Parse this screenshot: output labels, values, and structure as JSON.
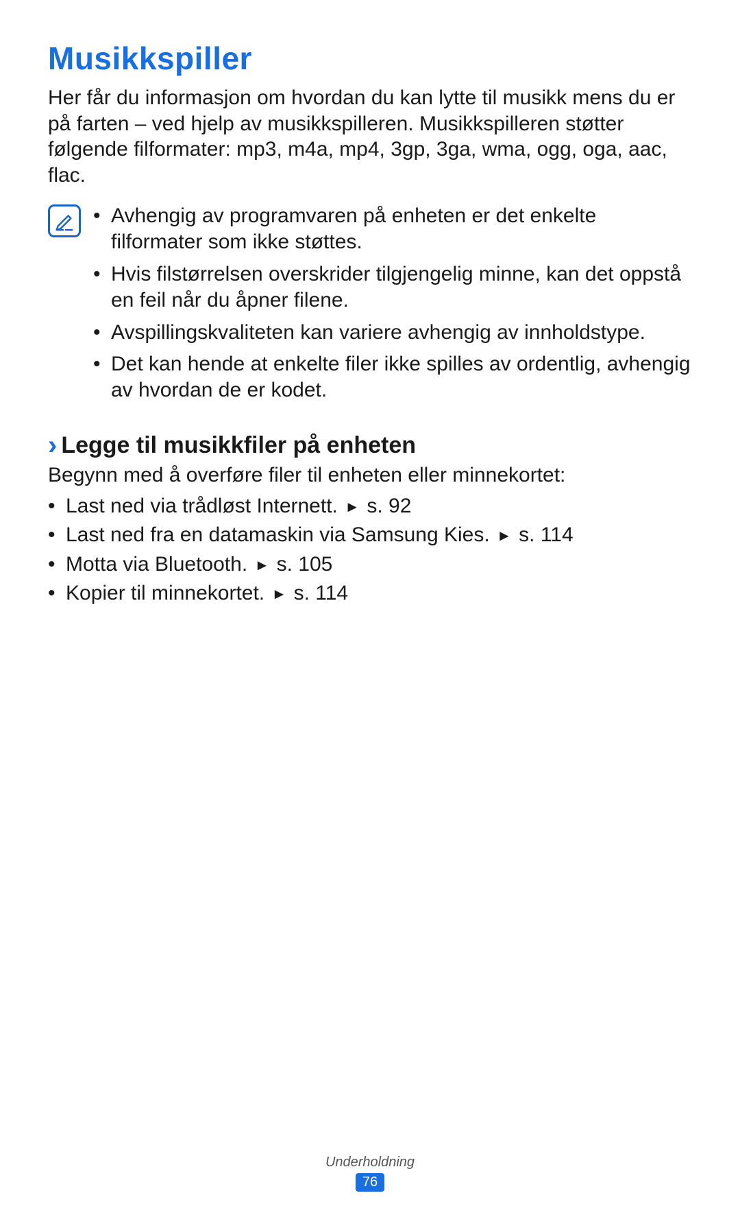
{
  "title": "Musikkspiller",
  "intro": "Her får du informasjon om hvordan du kan lytte til musikk mens du er på farten – ved hjelp av musikkspilleren. Musikkspilleren støtter følgende filformater: mp3, m4a, mp4, 3gp, 3ga, wma, ogg, oga, aac, flac.",
  "notes": [
    "Avhengig av programvaren på enheten er det enkelte filformater som ikke støttes.",
    "Hvis filstørrelsen overskrider tilgjengelig minne, kan det oppstå en feil når du åpner filene.",
    "Avspillingskvaliteten kan variere avhengig av innholdstype.",
    "Det kan hende at enkelte filer ikke spilles av ordentlig, avhengig av hvordan de er kodet."
  ],
  "subhead": "Legge til musikkfiler på enheten",
  "sub_intro": "Begynn med å overføre filer til enheten eller minnekortet:",
  "actions": [
    {
      "text": "Last ned via trådløst Internett.",
      "ref": "s. 92"
    },
    {
      "text": "Last ned fra en datamaskin via Samsung Kies.",
      "ref": "s. 114"
    },
    {
      "text": "Motta via Bluetooth.",
      "ref": "s. 105"
    },
    {
      "text": "Kopier til minnekortet.",
      "ref": "s. 114"
    }
  ],
  "footer": {
    "section": "Underholdning",
    "page": "76"
  }
}
